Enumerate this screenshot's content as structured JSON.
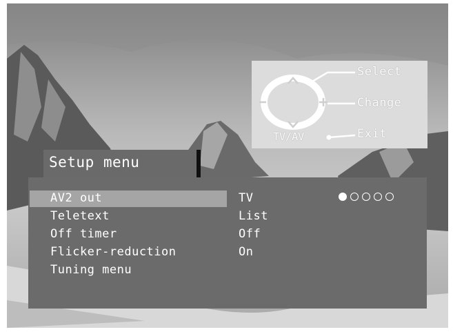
{
  "controls": {
    "select_label": "Select",
    "change_label": "Change",
    "exit_label": "Exit",
    "tvav_label": "TV/AV",
    "icons": [
      "up-arrow-icon",
      "down-arrow-icon",
      "minus-icon",
      "plus-icon"
    ]
  },
  "menu": {
    "title": "Setup menu",
    "items": [
      {
        "label": "AV2 out",
        "value": "TV"
      },
      {
        "label": "Teletext",
        "value": "List"
      },
      {
        "label": "Off timer",
        "value": "Off"
      },
      {
        "label": "Flicker-reduction",
        "value": "On"
      },
      {
        "label": "Tuning menu",
        "value": ""
      }
    ],
    "selected_index": 0,
    "selector_dots": {
      "total": 5,
      "active": 1
    }
  },
  "colors": {
    "panel": "#6b6b6b",
    "highlight": "#a5a5a5",
    "legend_box": "#dcdcdc",
    "text": "#ffffff"
  }
}
